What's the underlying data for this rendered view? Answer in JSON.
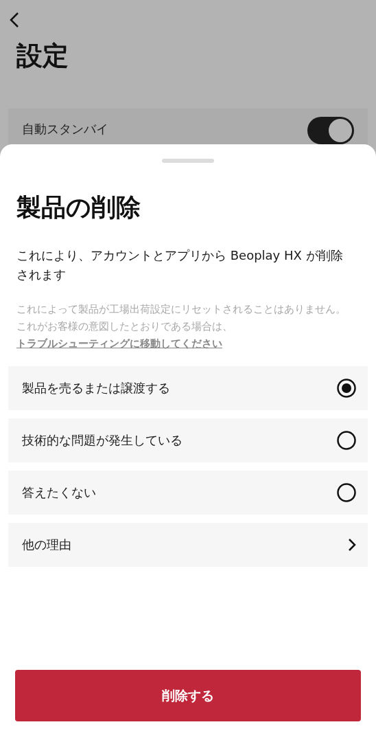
{
  "header": {
    "title": "設定"
  },
  "setting": {
    "label": "自動スタンバイ",
    "on": true
  },
  "sheet": {
    "title": "製品の削除",
    "description": "これにより、アカウントとアプリから Beoplay HX が削除されます",
    "note": {
      "line1": "これによって製品が工場出荷設定にリセットされることはありません。",
      "line2": "これがお客様の意図したとおりである場合は、",
      "link": "トラブルシューティングに移動してください"
    },
    "options": [
      {
        "kind": "radio",
        "label": "製品を売るまたは譲渡する",
        "selected": true
      },
      {
        "kind": "radio",
        "label": "技術的な問題が発生している",
        "selected": false
      },
      {
        "kind": "radio",
        "label": "答えたくない",
        "selected": false
      },
      {
        "kind": "link",
        "label": "他の理由"
      }
    ],
    "button": "削除する"
  }
}
